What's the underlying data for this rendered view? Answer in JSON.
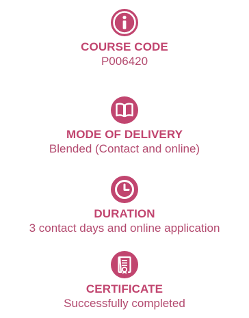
{
  "theme": {
    "label_color": "#c1456f",
    "value_color": "#b34a6f",
    "icon_color": "#c1456f"
  },
  "course_info": [
    {
      "icon": "info-icon",
      "label": "COURSE CODE",
      "value": "P006420"
    },
    {
      "icon": "book-icon",
      "label": "MODE OF DELIVERY",
      "value": "Blended (Contact and online)"
    },
    {
      "icon": "clock-icon",
      "label": "DURATION",
      "value": "3 contact days and online application"
    },
    {
      "icon": "certificate-icon",
      "label": "CERTIFICATE",
      "value": "Successfully completed"
    }
  ]
}
